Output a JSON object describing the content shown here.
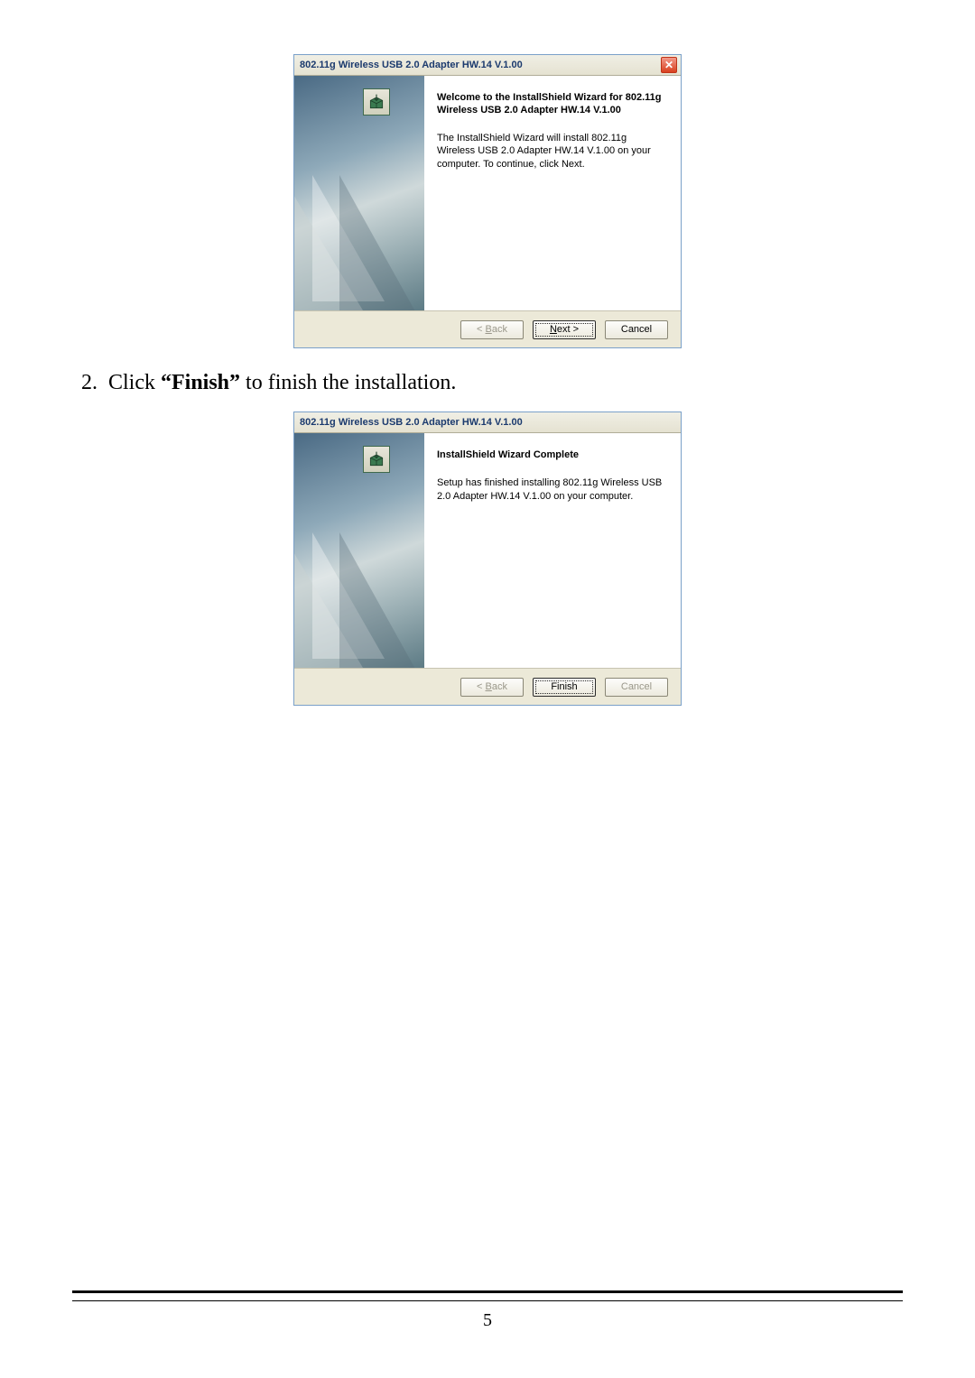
{
  "dialog1": {
    "title": "802.11g Wireless USB 2.0 Adapter HW.14 V.1.00",
    "close_glyph": "✕",
    "heading": "Welcome to the InstallShield Wizard for 802.11g Wireless USB 2.0 Adapter HW.14 V.1.00",
    "body": "The InstallShield Wizard will install 802.11g Wireless USB 2.0 Adapter HW.14 V.1.00 on your computer.  To continue, click Next.",
    "back_prefix": "< ",
    "back_u": "B",
    "back_rest": "ack",
    "next_u": "N",
    "next_rest": "ext >",
    "cancel": "Cancel"
  },
  "instruction": {
    "number": "2.",
    "prefix": "Click ",
    "bold": "“Finish”",
    "suffix": " to finish the installation."
  },
  "dialog2": {
    "title": "802.11g Wireless USB 2.0 Adapter HW.14 V.1.00",
    "heading": "InstallShield Wizard Complete",
    "body": "Setup has finished installing 802.11g Wireless USB 2.0 Adapter HW.14 V.1.00 on your computer.",
    "back_prefix": "< ",
    "back_u": "B",
    "back_rest": "ack",
    "finish": "Finish",
    "cancel": "Cancel"
  },
  "page_number": "5"
}
